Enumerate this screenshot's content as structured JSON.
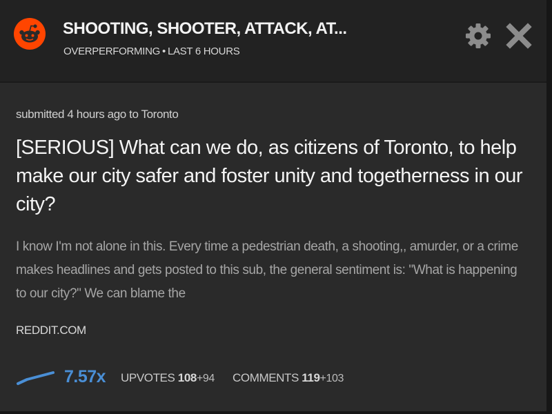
{
  "header": {
    "title": "SHOOTING, SHOOTER, ATTACK, AT...",
    "performance": "OVERPERFORMING",
    "separator": "•",
    "timeframe": "LAST 6 HOURS",
    "settings_icon": "gear-icon",
    "close_icon": "close-icon"
  },
  "post": {
    "submitted": "submitted 4 hours ago to Toronto",
    "title": "[SERIOUS] What can we do, as citizens of Toronto, to help make our city safer and foster unity and togetherness in our city?",
    "excerpt": "I know I'm not alone in this. Every time a pedestrian death, a shooting,, amurder, or a crime makes headlines and gets posted to this sub, the general sentiment is: \"What is happening to our city?\" We can blame the",
    "domain": "REDDIT.COM"
  },
  "stats": {
    "trend_icon": "trend-line-icon",
    "factor": "7.57x",
    "upvotes_label": "UPVOTES",
    "upvotes_value": "108",
    "upvotes_delta": "+94",
    "comments_label": "COMMENTS",
    "comments_value": "119",
    "comments_delta": "+103"
  },
  "colors": {
    "accent": "#4a8fd6",
    "reddit_orange": "#ff4500",
    "background": "#2a2a2a"
  }
}
